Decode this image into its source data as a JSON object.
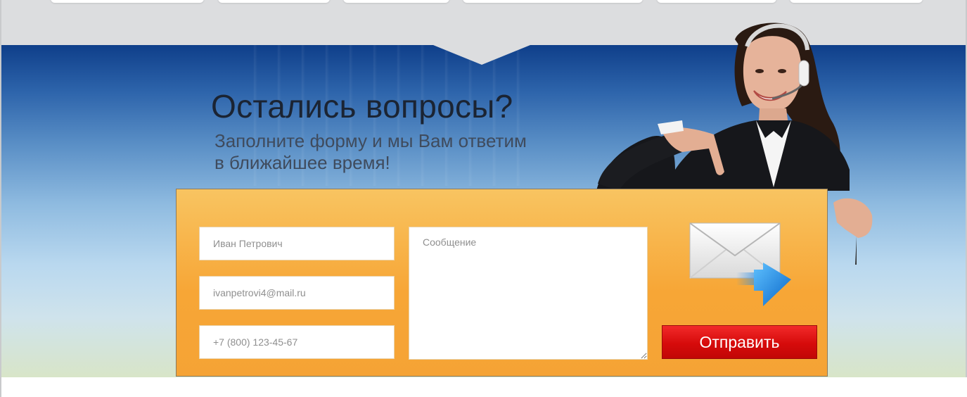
{
  "contact_section": {
    "heading": "Остались вопросы?",
    "subheading_line1": "Заполните форму и мы Вам ответим",
    "subheading_line2": "в ближайшее время!"
  },
  "form": {
    "name_placeholder": "Иван Петрович",
    "email_placeholder": "ivanpetrovi4@mail.ru",
    "phone_placeholder": "+7 (800) 123-45-67",
    "message_placeholder": "Сообщение",
    "submit_label": "Отправить"
  },
  "icons": {
    "envelope": "envelope-send-icon",
    "operator": "operator-woman-headset-image"
  },
  "colors": {
    "panel_orange": "#f7a636",
    "submit_red": "#d60b0b",
    "hero_blue": "#0f3f8a",
    "topbar_gray": "#dcdddf"
  }
}
